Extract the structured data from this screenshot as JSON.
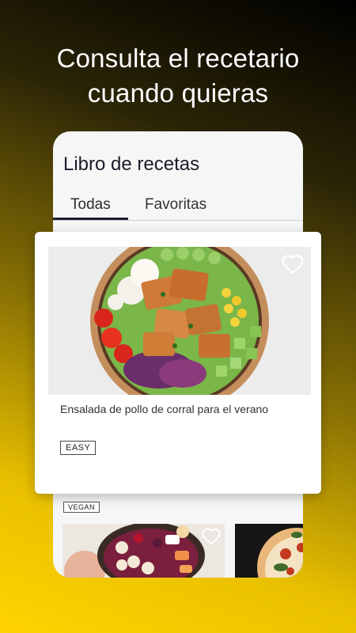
{
  "headline": {
    "line1": "Consulta el recetario",
    "line2": "cuando quieras"
  },
  "app": {
    "title": "Libro de recetas",
    "tabs": [
      {
        "label": "Todas",
        "active": true
      },
      {
        "label": "Favoritas",
        "active": false
      }
    ]
  },
  "featured_card": {
    "title": "Ensalada de pollo de corral para el verano",
    "badge": "EASY",
    "favorite_icon": "heart-outline-icon"
  },
  "list": {
    "badge": "VEGAN",
    "favorite_icon": "heart-outline-icon"
  },
  "colors": {
    "gradient_top": "#000000",
    "gradient_bottom": "#ffd400",
    "tab_underline": "#1b1d33"
  }
}
